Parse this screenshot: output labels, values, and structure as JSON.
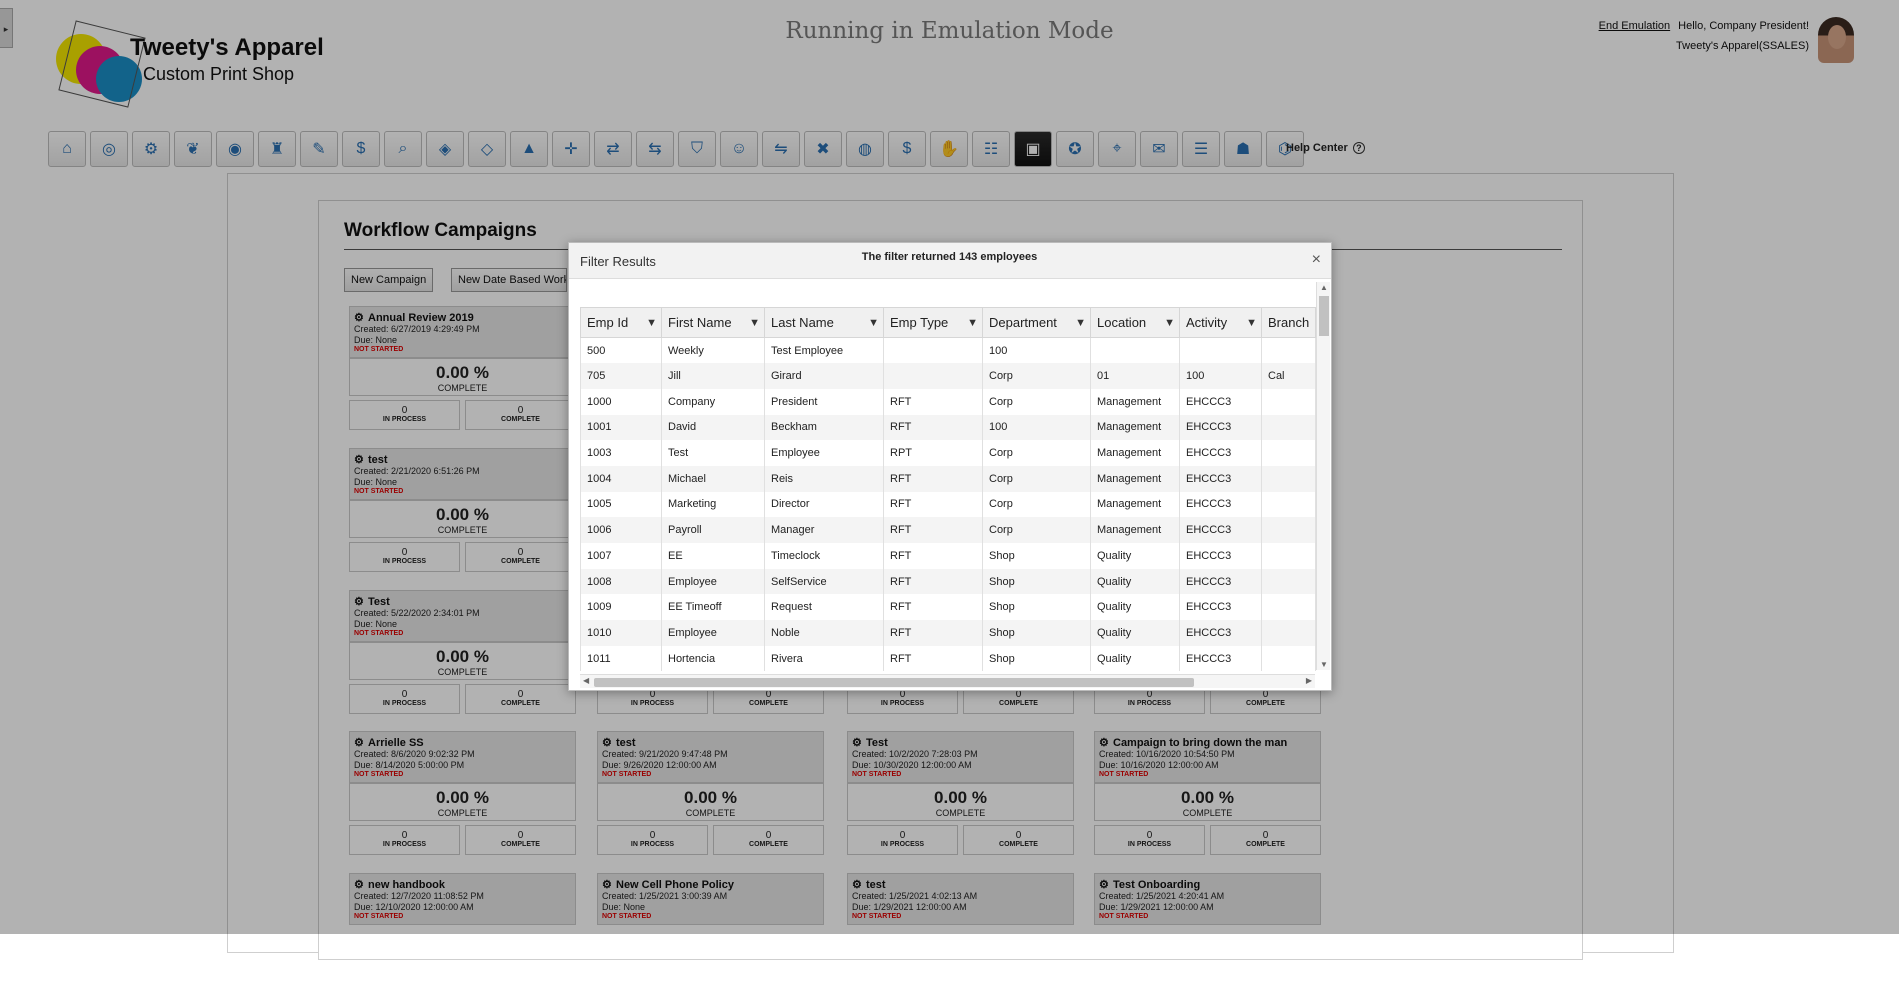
{
  "app": {
    "logo_title": "Tweety's Apparel",
    "logo_subtitle": "Custom Print Shop",
    "emulation_banner": "Running in Emulation Mode",
    "end_emulation": "End Emulation",
    "greeting": "Hello, Company President!",
    "company": "Tweety's Apparel(SSALES)",
    "help_center": "Help Center",
    "help_icon": "?"
  },
  "toolbar": {
    "icons": [
      "home-icon",
      "dashboard-icon",
      "settings-people-icon",
      "money-tree-icon",
      "team-icon",
      "org-chart-icon",
      "document-icon",
      "money-bag-icon",
      "search-person-icon",
      "target-icon",
      "target-alt-icon",
      "growth-icon",
      "crosshair-icon",
      "transfer-icon",
      "exchange-icon",
      "shield-icon",
      "employee-icon",
      "people-arrows-icon",
      "remove-person-icon",
      "globe-icon",
      "money-bag-alt-icon",
      "hand-coin-icon",
      "group-money-icon",
      "clipboard-icon",
      "badge-icon",
      "id-search-icon",
      "gift-icon",
      "report-icon",
      "meeting-icon",
      "analytics-icon"
    ],
    "glyphs": [
      "⌂",
      "◎",
      "⚙",
      "❦",
      "◉",
      "♜",
      "✎",
      "$",
      "⌕",
      "◈",
      "◇",
      "▲",
      "✛",
      "⇄",
      "⇆",
      "⛉",
      "☺",
      "⇋",
      "✖",
      "◍",
      "$",
      "✋",
      "☷",
      "▣",
      "✪",
      "⌖",
      "✉",
      "☰",
      "☗",
      "⌬"
    ]
  },
  "main": {
    "title": "Workflow Campaigns",
    "new_campaign": "New Campaign",
    "new_date_based": "New Date Based Work",
    "in_process_label": "IN PROCESS",
    "complete_label": "COMPLETE",
    "campaigns": [
      {
        "name": "Annual Review 2019",
        "created": "Created: 6/27/2019 4:29:49 PM",
        "due": "Due: None",
        "status": "NOT STARTED",
        "percent": "0.00 %",
        "in_process": "0",
        "complete": "0"
      },
      {
        "name": "test",
        "created": "Created: 2/21/2020 6:51:26 PM",
        "due": "Due: None",
        "status": "NOT STARTED",
        "percent": "0.00 %",
        "in_process": "0",
        "complete": "0"
      },
      {
        "name": "Test",
        "created": "Created: 5/22/2020 2:34:01 PM",
        "due": "Due: None",
        "status": "NOT STARTED",
        "percent": "0.00 %",
        "in_process": "0",
        "complete": "0"
      },
      {
        "name": "Arrielle SS",
        "created": "Created: 8/6/2020 9:02:32 PM",
        "due": "Due: 8/14/2020 5:00:00 PM",
        "status": "NOT STARTED",
        "percent": "0.00 %",
        "in_process": "0",
        "complete": "0"
      },
      {
        "name": "test",
        "created": "Created: 9/21/2020 9:47:48 PM",
        "due": "Due: 9/26/2020 12:00:00 AM",
        "status": "NOT STARTED",
        "percent": "0.00 %",
        "in_process": "0",
        "complete": "0"
      },
      {
        "name": "Test",
        "created": "Created: 10/2/2020 7:28:03 PM",
        "due": "Due: 10/30/2020 12:00:00 AM",
        "status": "NOT STARTED",
        "percent": "0.00 %",
        "in_process": "0",
        "complete": "0"
      },
      {
        "name": "Campaign to bring down the man",
        "created": "Created: 10/16/2020 10:54:50 PM",
        "due": "Due: 10/16/2020 12:00:00 AM",
        "status": "NOT STARTED",
        "percent": "0.00 %",
        "in_process": "0",
        "complete": "0"
      },
      {
        "name": "new handbook",
        "created": "Created: 12/7/2020 11:08:52 PM",
        "due": "Due: 12/10/2020 12:00:00 AM",
        "status": "NOT STARTED"
      },
      {
        "name": "New Cell Phone Policy",
        "created": "Created: 1/25/2021 3:00:39 AM",
        "due": "Due: None",
        "status": "NOT STARTED"
      },
      {
        "name": "test",
        "created": "Created: 1/25/2021 4:02:13 AM",
        "due": "Due: 1/29/2021 12:00:00 AM",
        "status": "NOT STARTED"
      },
      {
        "name": "Test Onboarding",
        "created": "Created: 1/25/2021 4:20:41 AM",
        "due": "Due: 1/29/2021 12:00:00 AM",
        "status": "NOT STARTED"
      }
    ],
    "row3_partial": [
      {
        "in_process": "0",
        "complete": "0"
      },
      {
        "in_process": "0",
        "complete": "0"
      },
      {
        "in_process": "0",
        "complete": "0"
      }
    ]
  },
  "modal": {
    "title": "Filter Results",
    "close": "×",
    "message": "The filter returned 143 employees",
    "filter_icon": "filter-icon",
    "columns": [
      "Emp Id",
      "First Name",
      "Last Name",
      "Emp Type",
      "Department",
      "Location",
      "Activity",
      "Branch"
    ],
    "rows": [
      [
        "500",
        "Weekly",
        "Test Employee",
        "",
        "100",
        "",
        "",
        ""
      ],
      [
        "705",
        "Jill",
        "Girard",
        "",
        "Corp",
        "01",
        "100",
        "Cal"
      ],
      [
        "1000",
        "Company",
        "President",
        "RFT",
        "Corp",
        "Management",
        "EHCCC3",
        ""
      ],
      [
        "1001",
        "David",
        "Beckham",
        "RFT",
        "100",
        "Management",
        "EHCCC3",
        ""
      ],
      [
        "1003",
        "Test",
        "Employee",
        "RPT",
        "Corp",
        "Management",
        "EHCCC3",
        ""
      ],
      [
        "1004",
        "Michael",
        "Reis",
        "RFT",
        "Corp",
        "Management",
        "EHCCC3",
        ""
      ],
      [
        "1005",
        "Marketing",
        "Director",
        "RFT",
        "Corp",
        "Management",
        "EHCCC3",
        ""
      ],
      [
        "1006",
        "Payroll",
        "Manager",
        "RFT",
        "Corp",
        "Management",
        "EHCCC3",
        ""
      ],
      [
        "1007",
        "EE",
        "Timeclock",
        "RFT",
        "Shop",
        "Quality",
        "EHCCC3",
        ""
      ],
      [
        "1008",
        "Employee",
        "SelfService",
        "RFT",
        "Shop",
        "Quality",
        "EHCCC3",
        ""
      ],
      [
        "1009",
        "EE Timeoff",
        "Request",
        "RFT",
        "Shop",
        "Quality",
        "EHCCC3",
        ""
      ],
      [
        "1010",
        "Employee",
        "Noble",
        "RFT",
        "Shop",
        "Quality",
        "EHCCC3",
        ""
      ],
      [
        "1011",
        "Hortencia",
        "Rivera",
        "RFT",
        "Shop",
        "Quality",
        "EHCCC3",
        ""
      ]
    ]
  }
}
